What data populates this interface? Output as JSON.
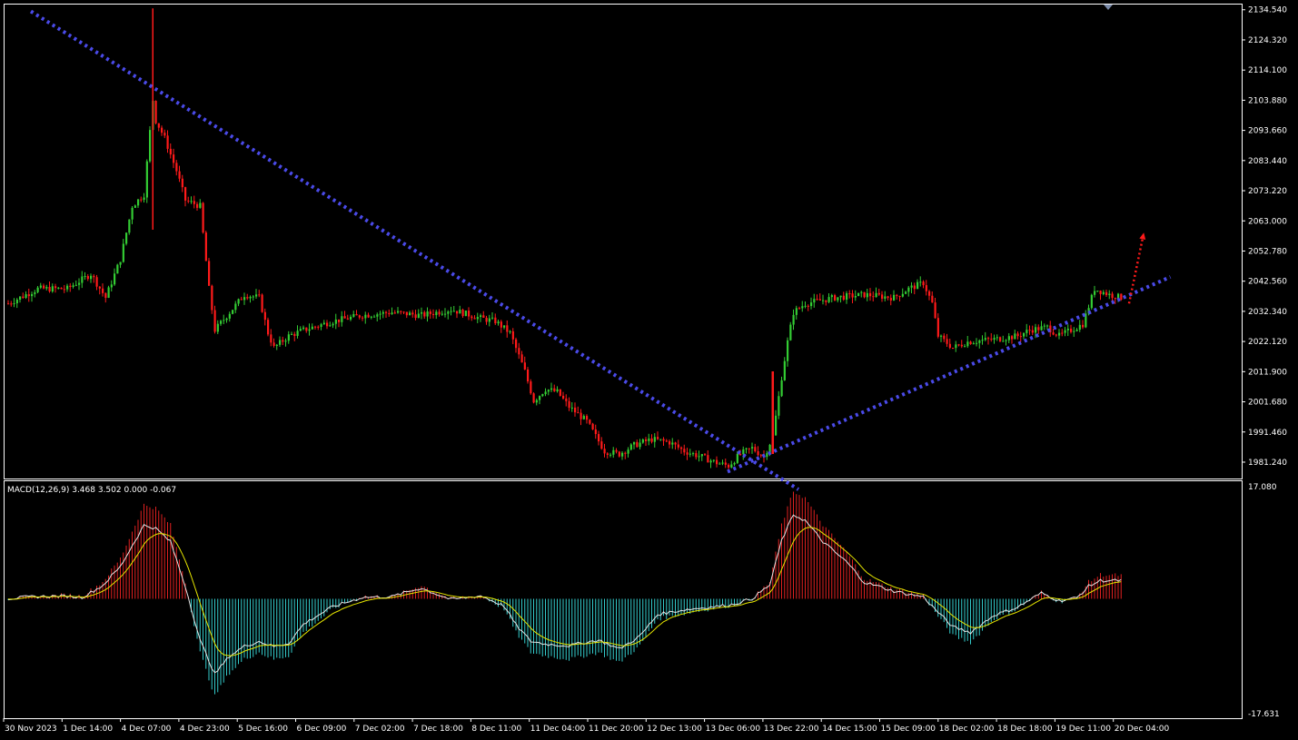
{
  "theme": {
    "background": "#000000",
    "frame": "#ffffff",
    "bull": "#33cc33",
    "bear": "#ff1a1a",
    "trendline": "#4a4ae8",
    "projection": "#ff1a1a",
    "macd_pos": "#e02020",
    "macd_neg": "#33cccc",
    "macd_line": "#e6e6e6",
    "signal_line": "#e6e600"
  },
  "price_axis": {
    "labels": [
      "2134.540",
      "2124.320",
      "2114.100",
      "2103.880",
      "2093.660",
      "2083.440",
      "2073.220",
      "2063.000",
      "2052.780",
      "2042.560",
      "2032.340",
      "2022.120",
      "2011.900",
      "2001.680",
      "1991.460",
      "1981.240"
    ]
  },
  "macd_axis": {
    "top_label": "17.080",
    "bottom_label": "-17.631"
  },
  "time_axis": {
    "labels": [
      "30 Nov 2023",
      "1 Dec 14:00",
      "4 Dec 07:00",
      "4 Dec 23:00",
      "5 Dec 16:00",
      "6 Dec 09:00",
      "7 Dec 02:00",
      "7 Dec 18:00",
      "8 Dec 11:00",
      "11 Dec 04:00",
      "11 Dec 20:00",
      "12 Dec 13:00",
      "13 Dec 06:00",
      "13 Dec 22:00",
      "14 Dec 15:00",
      "15 Dec 09:00",
      "18 Dec 02:00",
      "18 Dec 18:00",
      "19 Dec 11:00",
      "20 Dec 04:00"
    ]
  },
  "macd_indicator": {
    "label": "MACD(12,26,9) 3.468 3.502 0.000 -0.067"
  },
  "chart_data": {
    "type": "candlestick",
    "instrument_period": "H1",
    "y_range": [
      1976,
      2136
    ],
    "price_keypoints": [
      [
        0,
        2035
      ],
      [
        10,
        2040
      ],
      [
        20,
        2040
      ],
      [
        28,
        2045
      ],
      [
        33,
        2037
      ],
      [
        38,
        2050
      ],
      [
        42,
        2068
      ],
      [
        46,
        2072
      ],
      [
        49,
        2104
      ],
      [
        50,
        2097
      ],
      [
        53,
        2091
      ],
      [
        57,
        2080
      ],
      [
        60,
        2070
      ],
      [
        65,
        2068
      ],
      [
        68,
        2040
      ],
      [
        70,
        2026
      ],
      [
        75,
        2032
      ],
      [
        80,
        2038
      ],
      [
        85,
        2037
      ],
      [
        88,
        2025
      ],
      [
        90,
        2020
      ],
      [
        95,
        2024
      ],
      [
        100,
        2026
      ],
      [
        110,
        2029
      ],
      [
        115,
        2030
      ],
      [
        120,
        2031
      ],
      [
        130,
        2032
      ],
      [
        140,
        2031
      ],
      [
        150,
        2033
      ],
      [
        160,
        2030
      ],
      [
        165,
        2029
      ],
      [
        170,
        2025
      ],
      [
        175,
        2012
      ],
      [
        178,
        2002
      ],
      [
        182,
        2006
      ],
      [
        186,
        2005
      ],
      [
        190,
        2000
      ],
      [
        196,
        1995
      ],
      [
        202,
        1985
      ],
      [
        207,
        1984
      ],
      [
        212,
        1987
      ],
      [
        218,
        1989
      ],
      [
        224,
        1988
      ],
      [
        229,
        1985
      ],
      [
        235,
        1983
      ],
      [
        240,
        1981
      ],
      [
        244,
        1980
      ],
      [
        248,
        1984
      ],
      [
        252,
        1986
      ],
      [
        256,
        1983
      ],
      [
        259,
        1990
      ],
      [
        262,
        2010
      ],
      [
        264,
        2022
      ],
      [
        266,
        2032
      ],
      [
        270,
        2035
      ],
      [
        280,
        2037
      ],
      [
        290,
        2038
      ],
      [
        300,
        2037
      ],
      [
        305,
        2040
      ],
      [
        310,
        2042
      ],
      [
        313,
        2035
      ],
      [
        315,
        2024
      ],
      [
        320,
        2020
      ],
      [
        325,
        2022
      ],
      [
        335,
        2023
      ],
      [
        342,
        2024
      ],
      [
        346,
        2026
      ],
      [
        352,
        2027
      ],
      [
        356,
        2024
      ],
      [
        360,
        2026
      ],
      [
        364,
        2028
      ],
      [
        368,
        2040
      ],
      [
        373,
        2038
      ],
      [
        377,
        2037
      ]
    ],
    "macd_range": [
      -17.631,
      17.08
    ],
    "macd_keypoints": [
      [
        0,
        0.0
      ],
      [
        20,
        0.6
      ],
      [
        25,
        0.4
      ],
      [
        32,
        2.5
      ],
      [
        38,
        6.0
      ],
      [
        46,
        14.0
      ],
      [
        50,
        13.5
      ],
      [
        55,
        11.0
      ],
      [
        60,
        2.5
      ],
      [
        65,
        -8.0
      ],
      [
        70,
        -14.5
      ],
      [
        75,
        -11.0
      ],
      [
        80,
        -9.0
      ],
      [
        85,
        -8.0
      ],
      [
        90,
        -9.0
      ],
      [
        95,
        -8.5
      ],
      [
        100,
        -5.0
      ],
      [
        110,
        -1.5
      ],
      [
        115,
        -0.5
      ],
      [
        120,
        0.4
      ],
      [
        130,
        0.3
      ],
      [
        140,
        2.0
      ],
      [
        150,
        0.0
      ],
      [
        160,
        0.5
      ],
      [
        168,
        -1.5
      ],
      [
        172,
        -5.0
      ],
      [
        177,
        -8.0
      ],
      [
        182,
        -8.5
      ],
      [
        190,
        -9.0
      ],
      [
        200,
        -8.0
      ],
      [
        207,
        -9.5
      ],
      [
        214,
        -7.0
      ],
      [
        220,
        -3.0
      ],
      [
        226,
        -2.5
      ],
      [
        232,
        -2.0
      ],
      [
        238,
        -1.5
      ],
      [
        245,
        -1.0
      ],
      [
        252,
        0.0
      ],
      [
        258,
        2.5
      ],
      [
        262,
        11.0
      ],
      [
        266,
        16.0
      ],
      [
        270,
        15.0
      ],
      [
        276,
        11.0
      ],
      [
        284,
        7.0
      ],
      [
        290,
        3.0
      ],
      [
        300,
        1.5
      ],
      [
        310,
        0.5
      ],
      [
        314,
        -2.0
      ],
      [
        320,
        -5.5
      ],
      [
        326,
        -6.5
      ],
      [
        334,
        -3.0
      ],
      [
        342,
        -1.5
      ],
      [
        350,
        1.0
      ],
      [
        356,
        -0.5
      ],
      [
        362,
        0.2
      ],
      [
        366,
        2.5
      ],
      [
        370,
        3.6
      ],
      [
        376,
        3.5
      ]
    ],
    "trendlines": [
      {
        "name": "down trendline",
        "from": {
          "bar": 8,
          "price": 2134.0
        },
        "to": {
          "bar": 268,
          "price": 1972.0
        }
      },
      {
        "name": "up trendline",
        "from": {
          "bar": 244,
          "price": 1978.0
        },
        "to": {
          "bar": 394,
          "price": 2044.0
        }
      }
    ],
    "projection_arrow": {
      "from": {
        "bar": 380,
        "price": 2035.0
      },
      "to": {
        "bar": 385,
        "price": 2059.0
      }
    }
  }
}
